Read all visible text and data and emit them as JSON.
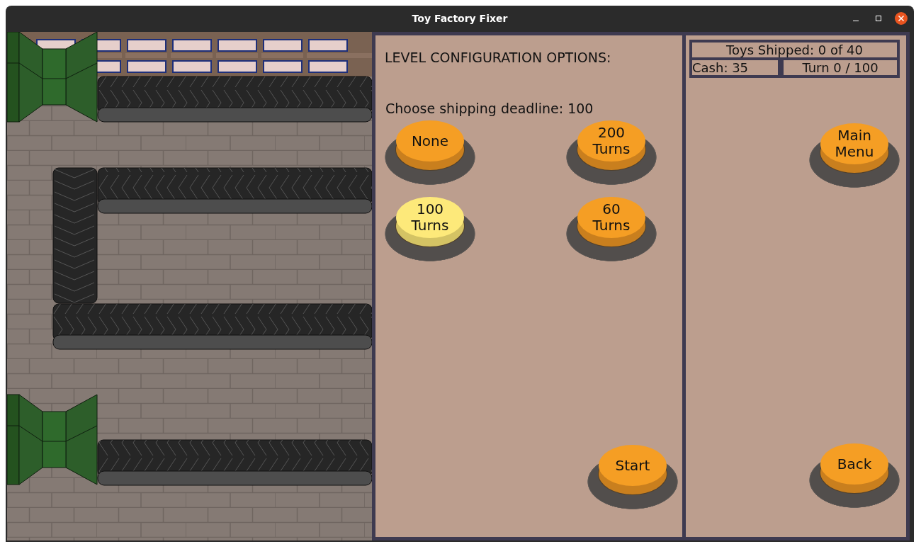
{
  "window": {
    "title": "Toy Factory Fixer"
  },
  "config": {
    "heading": "LEVEL CONFIGURATION OPTIONS:",
    "prompt": "Choose shipping deadline: 100",
    "options": [
      {
        "label": "None",
        "selected": false
      },
      {
        "label": "200 Turns",
        "selected": false
      },
      {
        "label": "100 Turns",
        "selected": true
      },
      {
        "label": "60 Turns",
        "selected": false
      }
    ],
    "start_button": "Start"
  },
  "status": {
    "toys_shipped": "Toys Shipped: 0 of 40",
    "cash": "Cash: 35",
    "turn": "Turn 0 / 100"
  },
  "main_menu_button": "Main Menu",
  "back_button": "Back"
}
